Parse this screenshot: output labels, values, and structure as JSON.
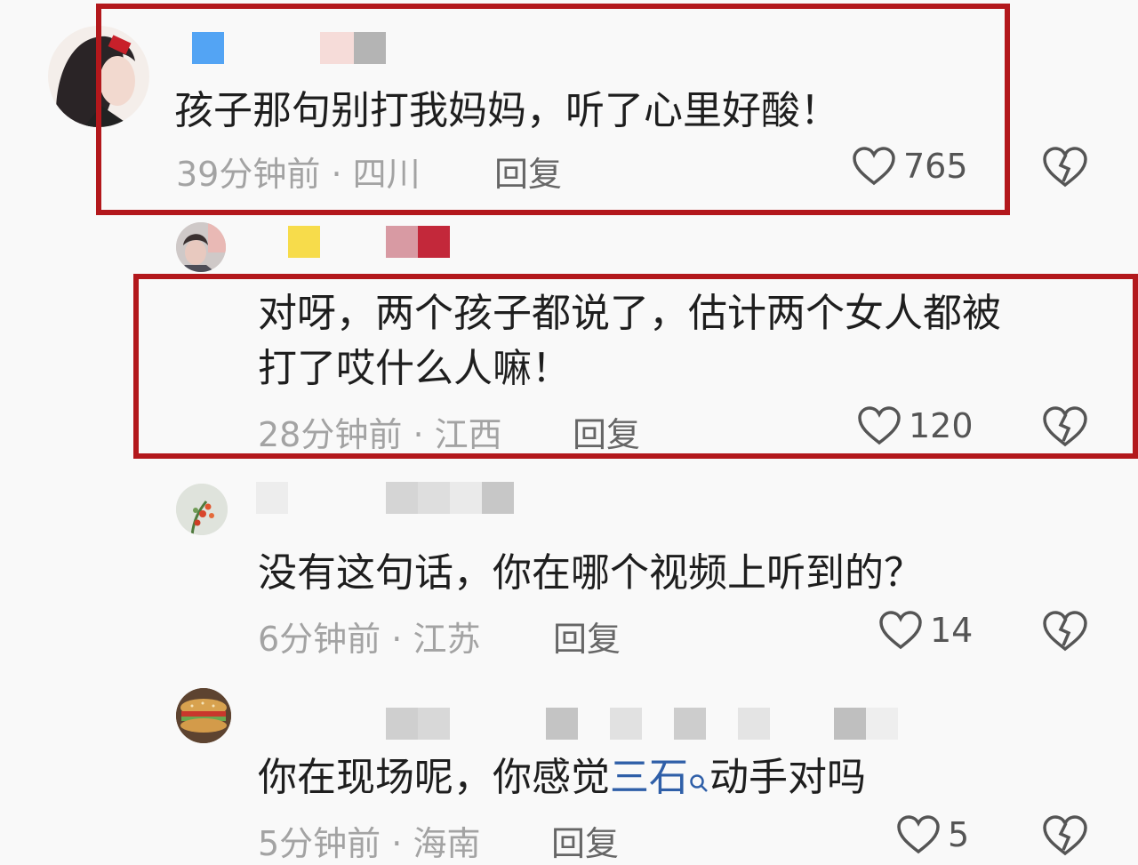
{
  "comments": [
    {
      "text": "孩子那句别打我妈妈，听了心里好酸！",
      "time": "39分钟前",
      "sep": "·",
      "location": "四川",
      "reply": "回复",
      "likes": "765"
    },
    {
      "text_line1": "对呀，两个孩子都说了，估计两个女人都被",
      "text_line2": "打了哎什么人嘛！",
      "time": "28分钟前",
      "sep": "·",
      "location": "江西",
      "reply": "回复",
      "likes": "120"
    },
    {
      "text": "没有这句话，你在哪个视频上听到的？",
      "time": "6分钟前",
      "sep": "·",
      "location": "江苏",
      "reply": "回复",
      "likes": "14"
    },
    {
      "text_before": "你在现场呢，你感觉",
      "text_link": "三石",
      "text_after": "动手对吗",
      "time": "5分钟前",
      "sep": "·",
      "location": "海南",
      "reply": "回复",
      "likes": "5"
    }
  ],
  "colors": {
    "highlight_frame": "#b3181c",
    "link": "#2f5fa8",
    "meta_text": "#a3a3a3"
  },
  "icons": [
    "heart-outline-icon",
    "broken-heart-icon",
    "search-icon"
  ]
}
